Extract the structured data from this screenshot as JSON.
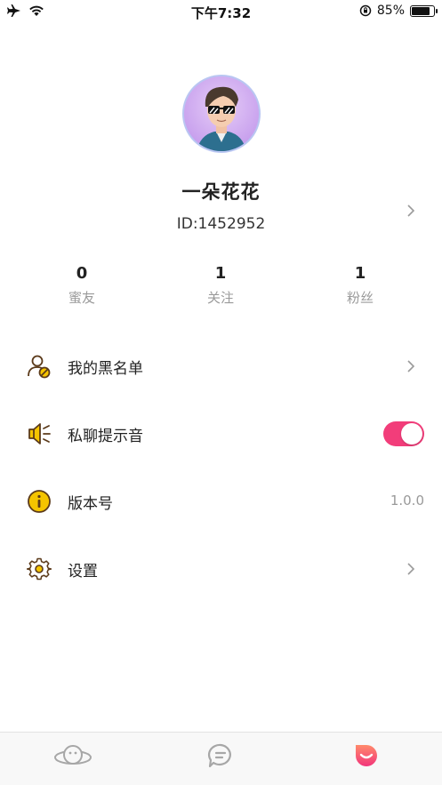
{
  "status_bar": {
    "time": "下午7:32",
    "battery_percent": "85%",
    "battery_level": 0.85,
    "icons": [
      "airplane-icon",
      "wifi-icon",
      "orientation-lock-icon",
      "battery-icon"
    ]
  },
  "profile": {
    "nickname": "一朵花花",
    "id_text": "ID:1452952",
    "avatar": "avatar-sunglasses-man"
  },
  "stats": [
    {
      "value": "0",
      "label": "蜜友"
    },
    {
      "value": "1",
      "label": "关注"
    },
    {
      "value": "1",
      "label": "粉丝"
    }
  ],
  "menu": {
    "blacklist": {
      "label": "我的黑名单",
      "icon": "user-block-icon"
    },
    "chat_sound": {
      "label": "私聊提示音",
      "icon": "speaker-icon",
      "enabled": true
    },
    "version": {
      "label": "版本号",
      "value": "1.0.0",
      "icon": "info-icon"
    },
    "settings": {
      "label": "设置",
      "icon": "gear-icon"
    }
  },
  "tabbar": {
    "tabs": [
      {
        "name": "discover",
        "icon": "planet-icon",
        "active": false
      },
      {
        "name": "messages",
        "icon": "chat-bubble-icon",
        "active": false
      },
      {
        "name": "me",
        "icon": "smile-bubble-icon",
        "active": true
      }
    ]
  },
  "colors": {
    "accent": "#f23d7a",
    "icon_brown": "#5b3a1a",
    "icon_yellow": "#f5c400",
    "muted_text": "#9a9a9a",
    "tab_inactive": "#a7a7a7"
  }
}
